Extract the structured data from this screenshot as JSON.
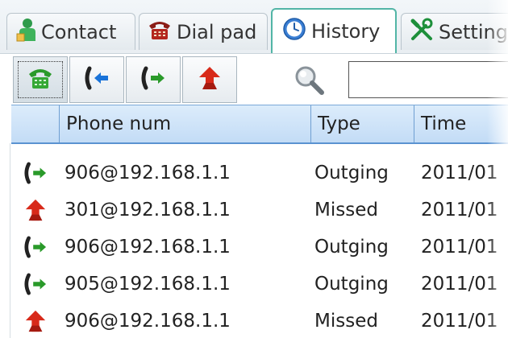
{
  "tabs": [
    {
      "label": "Contact",
      "icon": "contact-icon"
    },
    {
      "label": "Dial pad",
      "icon": "telephone-icon"
    },
    {
      "label": "History",
      "icon": "clock-icon",
      "active": true
    },
    {
      "label": "Settings",
      "icon": "tools-icon"
    }
  ],
  "toolbar": {
    "buttons": [
      {
        "name": "all-calls",
        "icon": "phone-icon",
        "selected": true
      },
      {
        "name": "incoming-calls",
        "icon": "incoming-call-icon"
      },
      {
        "name": "outgoing-calls",
        "icon": "outgoing-call-icon"
      },
      {
        "name": "missed-calls",
        "icon": "missed-call-icon"
      }
    ],
    "search": {
      "icon": "magnifier-icon",
      "value": "",
      "placeholder": ""
    }
  },
  "table": {
    "columns": [
      "",
      "Phone num",
      "Type",
      "Time"
    ],
    "rows": [
      {
        "icon": "outgoing-call-icon",
        "phone": "906@192.168.1.1",
        "type": "Outging",
        "time": "2011/01"
      },
      {
        "icon": "missed-call-icon",
        "phone": "301@192.168.1.1",
        "type": "Missed",
        "time": "2011/01"
      },
      {
        "icon": "outgoing-call-icon",
        "phone": "906@192.168.1.1",
        "type": "Outging",
        "time": "2011/01"
      },
      {
        "icon": "outgoing-call-icon",
        "phone": "905@192.168.1.1",
        "type": "Outging",
        "time": "2011/01"
      },
      {
        "icon": "missed-call-icon",
        "phone": "906@192.168.1.1",
        "type": "Missed",
        "time": "2011/01"
      }
    ]
  },
  "colors": {
    "active_tab_border": "#52b5a6",
    "header_bg": "#c3dcf6",
    "outgoing_green": "#2a9a2a",
    "missed_red": "#d82a1a",
    "incoming_blue": "#1a73d9"
  }
}
